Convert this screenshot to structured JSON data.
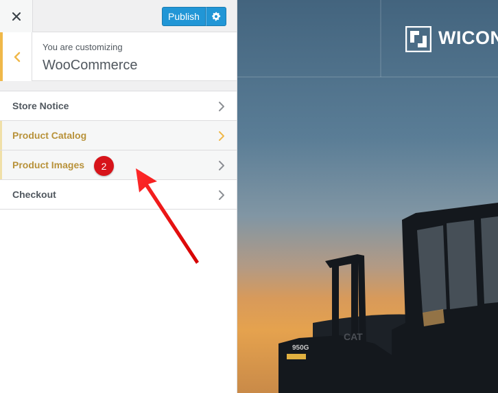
{
  "topbar": {
    "close_icon": "close-icon",
    "publish_label": "Publish",
    "settings_icon": "gear-icon",
    "accent": "#2196d6"
  },
  "section": {
    "customizing_label": "You are customizing",
    "title": "WooCommerce",
    "back_icon": "chevron-left-icon",
    "accent": "#f0b849"
  },
  "panels": [
    {
      "label": "Store Notice",
      "highlighted": false
    },
    {
      "label": "Product Catalog",
      "highlighted": true
    },
    {
      "label": "Product Images",
      "highlighted": true
    },
    {
      "label": "Checkout",
      "highlighted": false
    }
  ],
  "annotation": {
    "badge": "2",
    "color": "#d7141a"
  },
  "preview": {
    "logo_text": "WICON"
  }
}
